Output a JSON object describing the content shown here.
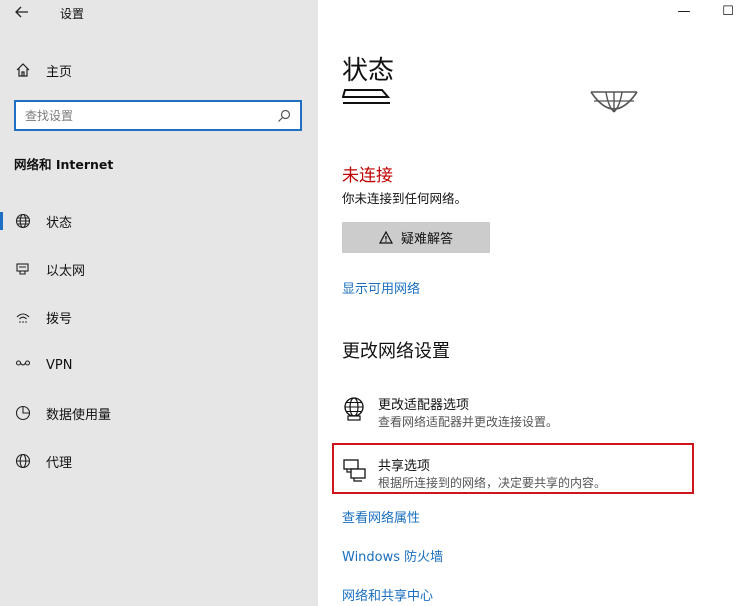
{
  "window": {
    "title": "设置",
    "minimize_label": "—",
    "maximize_label": "☐"
  },
  "sidebar": {
    "home_label": "主页",
    "search_placeholder": "查找设置",
    "section_title": "网络和 Internet",
    "items": [
      {
        "label": "状态",
        "icon": "globe-icon",
        "active": true
      },
      {
        "label": "以太网",
        "icon": "ethernet-icon",
        "active": false
      },
      {
        "label": "拨号",
        "icon": "dialup-icon",
        "active": false
      },
      {
        "label": "VPN",
        "icon": "vpn-icon",
        "active": false
      },
      {
        "label": "数据使用量",
        "icon": "data-usage-icon",
        "active": false
      },
      {
        "label": "代理",
        "icon": "proxy-globe-icon",
        "active": false
      }
    ]
  },
  "main": {
    "title": "状态",
    "connection_status": "未连接",
    "connection_desc": "你未连接到任何网络。",
    "troubleshoot_label": "疑难解答",
    "show_networks_link": "显示可用网络",
    "change_settings_title": "更改网络设置",
    "settings": [
      {
        "name": "更改适配器选项",
        "desc": "查看网络适配器并更改连接设置。",
        "icon": "adapter-globe-icon"
      },
      {
        "name": "共享选项",
        "desc": "根据所连接到的网络，决定要共享的内容。",
        "icon": "sharing-icon"
      }
    ],
    "links": [
      "查看网络属性",
      "Windows 防火墙",
      "网络和共享中心"
    ]
  },
  "colors": {
    "accent": "#1f6fc4",
    "link": "#1a6fbf",
    "error": "#c00000",
    "highlight": "#d0141c",
    "sidebar_bg": "#e6e6e6"
  }
}
